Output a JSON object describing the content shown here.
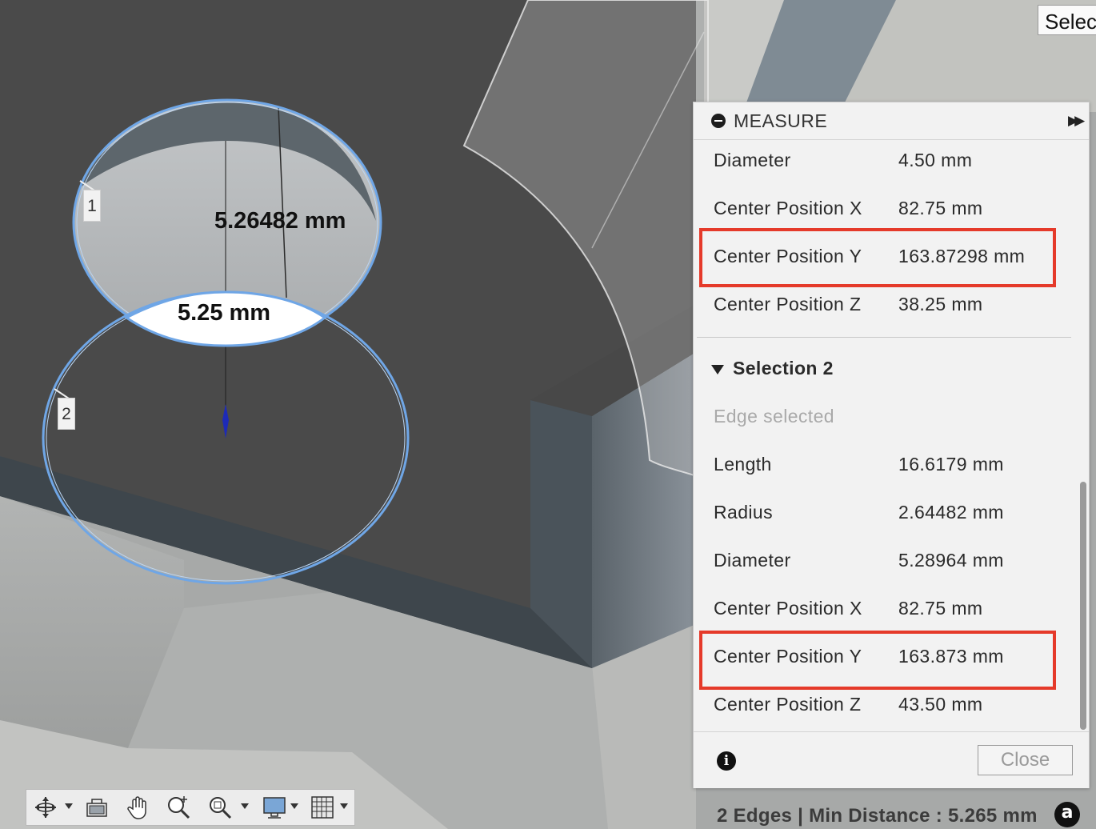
{
  "select_button": {
    "label": "Selec"
  },
  "viewport": {
    "dimensions": {
      "first": "5.26482 mm",
      "second": "5.25 mm"
    },
    "edge_markers": [
      "1",
      "2"
    ]
  },
  "measure_panel": {
    "title": "MEASURE",
    "selection1_rows": [
      {
        "label": "Diameter",
        "value": "4.50 mm"
      },
      {
        "label": "Center Position X",
        "value": "82.75 mm"
      },
      {
        "label": "Center Position Y",
        "value": "163.87298 mm"
      },
      {
        "label": "Center Position Z",
        "value": "38.25 mm"
      }
    ],
    "selection2": {
      "title": "Selection 2",
      "subtitle": "Edge selected",
      "rows": [
        {
          "label": "Length",
          "value": "16.6179 mm"
        },
        {
          "label": "Radius",
          "value": "2.64482 mm"
        },
        {
          "label": "Diameter",
          "value": "5.28964 mm"
        },
        {
          "label": "Center Position X",
          "value": "82.75 mm"
        },
        {
          "label": "Center Position Y",
          "value": "163.873 mm"
        },
        {
          "label": "Center Position Z",
          "value": "43.50 mm"
        }
      ]
    },
    "close_label": "Close"
  },
  "status_bar": {
    "text": "2 Edges | Min Distance : 5.265 mm"
  },
  "nav_toolbar": {
    "tools": [
      "orbit-icon",
      "look-at-icon",
      "pan-icon",
      "zoom-icon",
      "zoom-window-icon",
      "display-settings-icon",
      "grid-settings-icon"
    ]
  },
  "colors": {
    "highlight": "#e53a2a",
    "selection_edge": "#6fa6e6",
    "panel_bg": "#f2f2f2"
  }
}
